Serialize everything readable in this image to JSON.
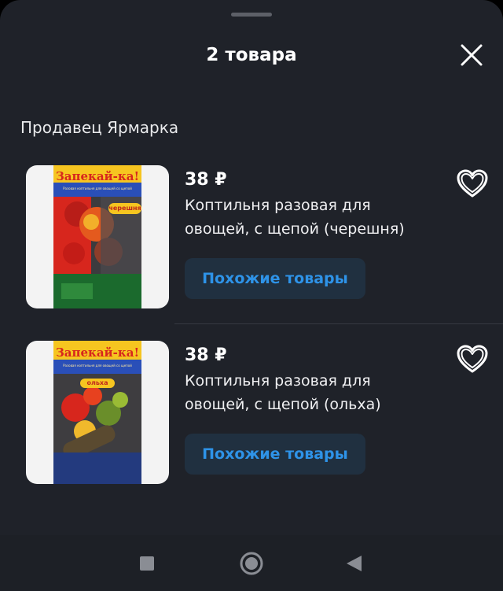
{
  "header": {
    "title": "2 товара",
    "close_icon": "close-icon"
  },
  "seller": {
    "label": "Продавец Ярмарка"
  },
  "items": [
    {
      "price": "38 ₽",
      "name_line1": "Коптильня разовая для",
      "name_line2": "овощей, с щепой (черешня)",
      "similar_label": "Похожие товары",
      "package_brand": "Запекай-ка!",
      "package_subtitle": "Разовая коптильня для овощей со щепой",
      "package_flavor": "черешня",
      "favorite_icon": "heart-outline-icon"
    },
    {
      "price": "38 ₽",
      "name_line1": "Коптильня разовая для",
      "name_line2": "овощей, с щепой (ольха)",
      "similar_label": "Похожие товары",
      "package_brand": "Запекай-ка!",
      "package_subtitle": "Разовая коптильня для овощей со щепой",
      "package_flavor": "ольха",
      "favorite_icon": "heart-outline-icon"
    }
  ],
  "system_nav": {
    "buttons": [
      "recents-square-icon",
      "home-circle-icon",
      "back-triangle-icon"
    ]
  },
  "colors": {
    "sheet_background": "#1f2229",
    "accent_link": "#2e93e8",
    "button_background": "#203040",
    "package_red": "#d7261d",
    "package_blue": "#2a4fb8",
    "package_yellow": "#f6c520"
  }
}
